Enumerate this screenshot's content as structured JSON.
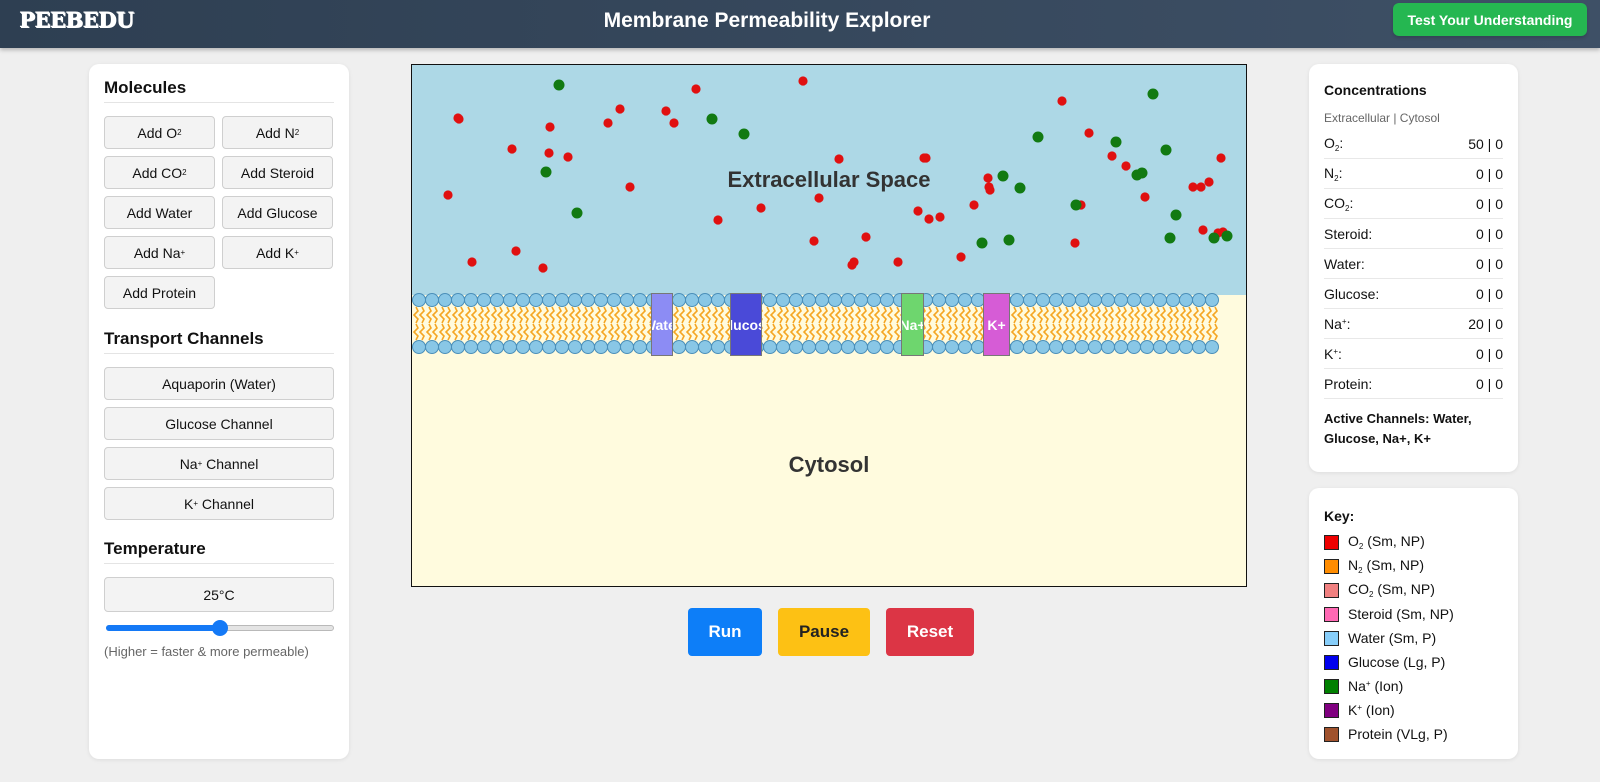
{
  "header": {
    "logo": "PEEBEDU",
    "title": "Membrane Permeability Explorer",
    "test_button": "Test Your Understanding"
  },
  "molecules": {
    "title": "Molecules",
    "buttons": [
      {
        "pre": "Add O",
        "sub": "2",
        "sup": ""
      },
      {
        "pre": "Add N",
        "sub": "2",
        "sup": ""
      },
      {
        "pre": "Add CO",
        "sub": "2",
        "sup": ""
      },
      {
        "pre": "Add Steroid",
        "sub": "",
        "sup": ""
      },
      {
        "pre": "Add Water",
        "sub": "",
        "sup": ""
      },
      {
        "pre": "Add Glucose",
        "sub": "",
        "sup": ""
      },
      {
        "pre": "Add Na",
        "sub": "",
        "sup": "+"
      },
      {
        "pre": "Add K",
        "sub": "",
        "sup": "+"
      },
      {
        "pre": "Add Protein",
        "sub": "",
        "sup": ""
      }
    ]
  },
  "channels": {
    "title": "Transport Channels",
    "buttons": [
      {
        "pre": "Aquaporin (Water)",
        "sup": "",
        "post": ""
      },
      {
        "pre": "Glucose Channel",
        "sup": "",
        "post": ""
      },
      {
        "pre": "Na",
        "sup": "+",
        "post": " Channel"
      },
      {
        "pre": "K",
        "sup": "+",
        "post": " Channel"
      }
    ]
  },
  "temperature": {
    "title": "Temperature",
    "value": "25°C",
    "level": 0.5,
    "hint": "(Higher = faster & more permeable)"
  },
  "simulation": {
    "extracellular_label": "Extracellular Space",
    "cytosol_label": "Cytosol",
    "membrane_channels": [
      {
        "label": "Water",
        "color": "#8c8cf4"
      },
      {
        "label": "Glucose",
        "color": "#4a4ad8"
      },
      {
        "label": "Na+",
        "color": "#6ed66e"
      },
      {
        "label": "K+",
        "color": "#d65cd6"
      }
    ],
    "particle_colors": {
      "O2": "#e01010",
      "Na": "#127a12"
    }
  },
  "controls": {
    "run": "Run",
    "pause": "Pause",
    "reset": "Reset",
    "colors": {
      "run": "#0d7ef8",
      "pause": "#fdc114",
      "reset": "#dc3545"
    }
  },
  "concentrations": {
    "title": "Concentrations",
    "subtitle": "Extracellular | Cytosol",
    "rows": [
      {
        "name": "O",
        "sub": "2",
        "sup": "",
        "value": "50 | 0"
      },
      {
        "name": "N",
        "sub": "2",
        "sup": "",
        "value": "0 | 0"
      },
      {
        "name": "CO",
        "sub": "2",
        "sup": "",
        "value": "0 | 0"
      },
      {
        "name": "Steroid",
        "sub": "",
        "sup": "",
        "value": "0 | 0"
      },
      {
        "name": "Water",
        "sub": "",
        "sup": "",
        "value": "0 | 0"
      },
      {
        "name": "Glucose",
        "sub": "",
        "sup": "",
        "value": "0 | 0"
      },
      {
        "name": "Na",
        "sub": "",
        "sup": "+",
        "value": "20 | 0"
      },
      {
        "name": "K",
        "sub": "",
        "sup": "+",
        "value": "0 | 0"
      },
      {
        "name": "Protein",
        "sub": "",
        "sup": "",
        "value": "0 | 0"
      }
    ],
    "active_channels": "Active Channels: Water, Glucose, Na+, K+"
  },
  "key": {
    "title": "Key:",
    "items": [
      {
        "pre": "O",
        "sub": "2",
        "sup": "",
        "post": " (Sm, NP)",
        "color": "#ee0000"
      },
      {
        "pre": "N",
        "sub": "2",
        "sup": "",
        "post": " (Sm, NP)",
        "color": "#ff8c00"
      },
      {
        "pre": "CO",
        "sub": "2",
        "sup": "",
        "post": " (Sm, NP)",
        "color": "#f08080"
      },
      {
        "pre": "Steroid (Sm, NP)",
        "sub": "",
        "sup": "",
        "post": "",
        "color": "#ff69b4"
      },
      {
        "pre": "Water (Sm, P)",
        "sub": "",
        "sup": "",
        "post": "",
        "color": "#87cefa"
      },
      {
        "pre": "Glucose (Lg, P)",
        "sub": "",
        "sup": "",
        "post": "",
        "color": "#0000ee"
      },
      {
        "pre": "Na",
        "sub": "",
        "sup": "+",
        "post": " (Ion)",
        "color": "#008000"
      },
      {
        "pre": "K",
        "sub": "",
        "sup": "+",
        "post": " (Ion)",
        "color": "#800080"
      },
      {
        "pre": "Protein (VLg, P)",
        "sub": "",
        "sup": "",
        "post": "",
        "color": "#a0522d"
      }
    ]
  }
}
